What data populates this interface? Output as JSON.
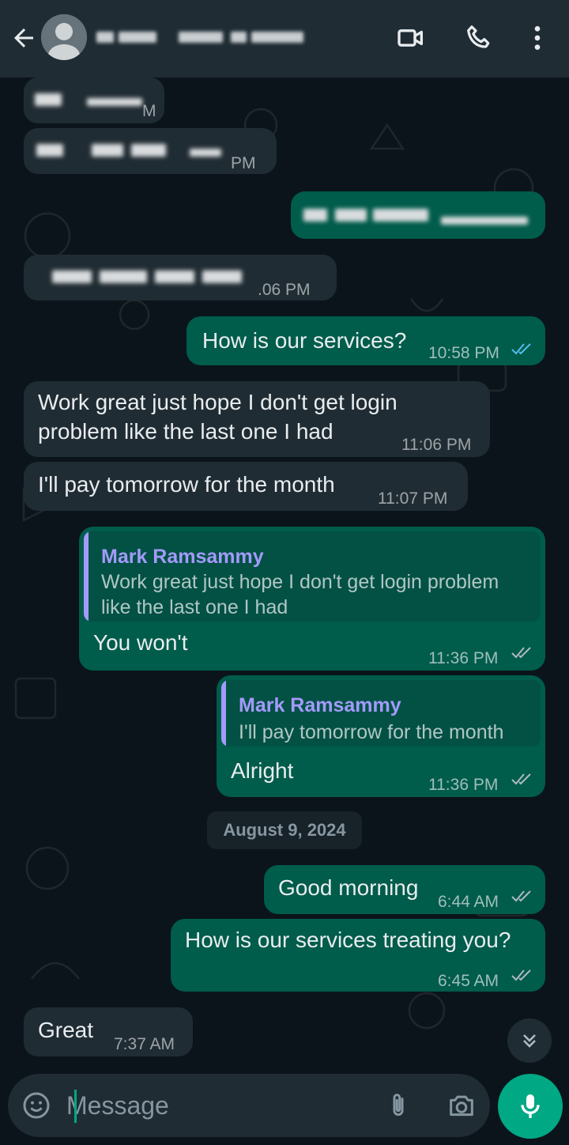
{
  "header": {
    "contact_name": "",
    "icons": [
      "back-arrow-icon",
      "avatar-icon",
      "video-call-icon",
      "voice-call-icon",
      "more-options-icon"
    ]
  },
  "messages": [
    {
      "id": "m1",
      "direction": "in",
      "text": "",
      "time": "M",
      "blurred": true
    },
    {
      "id": "m2",
      "direction": "in",
      "text": "",
      "time": "PM",
      "blurred": true
    },
    {
      "id": "m3",
      "direction": "out",
      "text": "",
      "time": "",
      "blurred": true
    },
    {
      "id": "m4",
      "direction": "in",
      "text": "",
      "time": ".06 PM",
      "blurred": true
    },
    {
      "id": "m5",
      "direction": "out",
      "text": "How is our services?",
      "time": "10:58 PM",
      "status": "read"
    },
    {
      "id": "m6",
      "direction": "in",
      "lines": [
        "Work great just hope I don't get login",
        "problem like the last one I had"
      ],
      "time": "11:06 PM"
    },
    {
      "id": "m7",
      "direction": "in",
      "text": "I'll pay tomorrow for the month",
      "time": "11:07 PM"
    },
    {
      "id": "m8",
      "direction": "out",
      "quote": {
        "author": "Mark Ramsammy",
        "lines": [
          "Work great just hope I don't get login problem",
          "like the last one I had"
        ]
      },
      "text": "You won't",
      "time": "11:36 PM",
      "status": "delivered"
    },
    {
      "id": "m9",
      "direction": "out",
      "quote": {
        "author": "Mark Ramsammy",
        "lines": [
          "I'll pay tomorrow for the month"
        ]
      },
      "text": "Alright",
      "time": "11:36 PM",
      "status": "delivered"
    },
    {
      "id": "m10",
      "direction": "out",
      "text": "Good morning",
      "time": "6:44 AM",
      "status": "delivered"
    },
    {
      "id": "m11",
      "direction": "out",
      "text": "How is our services treating you?",
      "time": "6:45 AM",
      "status": "delivered"
    },
    {
      "id": "m12",
      "direction": "in",
      "text": "Great",
      "time": "7:37 AM"
    }
  ],
  "date_separator": "August 9, 2024",
  "composer": {
    "placeholder": "Message",
    "icons": [
      "emoji-icon",
      "attach-icon",
      "camera-icon",
      "mic-icon"
    ]
  },
  "colors": {
    "background": "#0b141a",
    "header": "#1f2c34",
    "incoming_bubble": "#202c33",
    "outgoing_bubble": "#005c4b",
    "accent": "#00a884",
    "quote_author": "#a49afc",
    "read_tick": "#53bdeb"
  }
}
